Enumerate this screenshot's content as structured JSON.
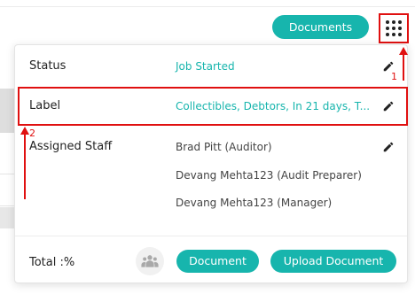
{
  "header": {
    "documents_button": "Documents",
    "apps_icon": "grid-dots-icon"
  },
  "panel": {
    "status": {
      "label": "Status",
      "value": "Job Started"
    },
    "label_row": {
      "label": "Label",
      "value": "Collectibles, Debtors, In 21 days, T..."
    },
    "assigned_staff": {
      "label": "Assigned Staff",
      "members": [
        "Brad Pitt (Auditor)",
        "Devang Mehta123 (Audit Preparer)",
        "Devang Mehta123 (Manager)"
      ]
    },
    "footer": {
      "total_label": "Total :%",
      "document_button": "Document",
      "upload_button": "Upload Document"
    }
  },
  "annotations": {
    "marker_1": "1",
    "marker_2": "2"
  },
  "colors": {
    "accent": "#17b5ad",
    "annotation": "#e01010"
  }
}
